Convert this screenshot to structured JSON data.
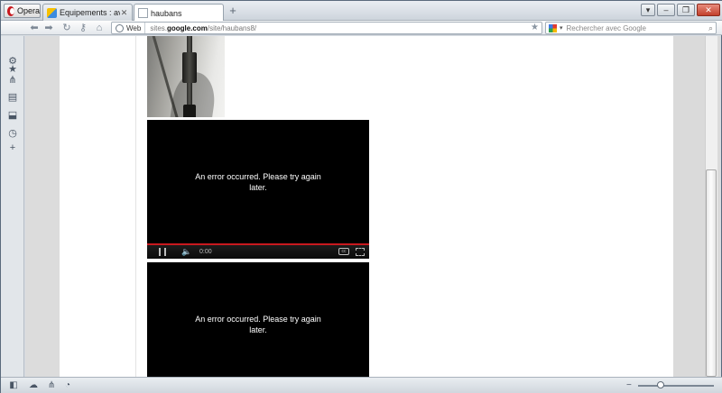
{
  "browser": {
    "menu_label": "Opera",
    "tabs": [
      {
        "label": "Equipements : avis co..."
      },
      {
        "label": "haubans"
      }
    ],
    "newtab_label": "+"
  },
  "address": {
    "web_label": "Web",
    "url_prefix": "sites.",
    "url_domain": "google.com",
    "url_path": "/site/haubans8/"
  },
  "search": {
    "placeholder": "Rechercher avec Google"
  },
  "videos": [
    {
      "error_text": "An error occurred. Please try again later.",
      "time": "0:00",
      "progress": 1.0
    },
    {
      "error_text": "An error occurred. Please try again later."
    }
  ],
  "statusbar": {
    "zoom_level": 0.3
  },
  "colors": {
    "progress": "#c8191e",
    "opera_red": "#c8171e"
  }
}
